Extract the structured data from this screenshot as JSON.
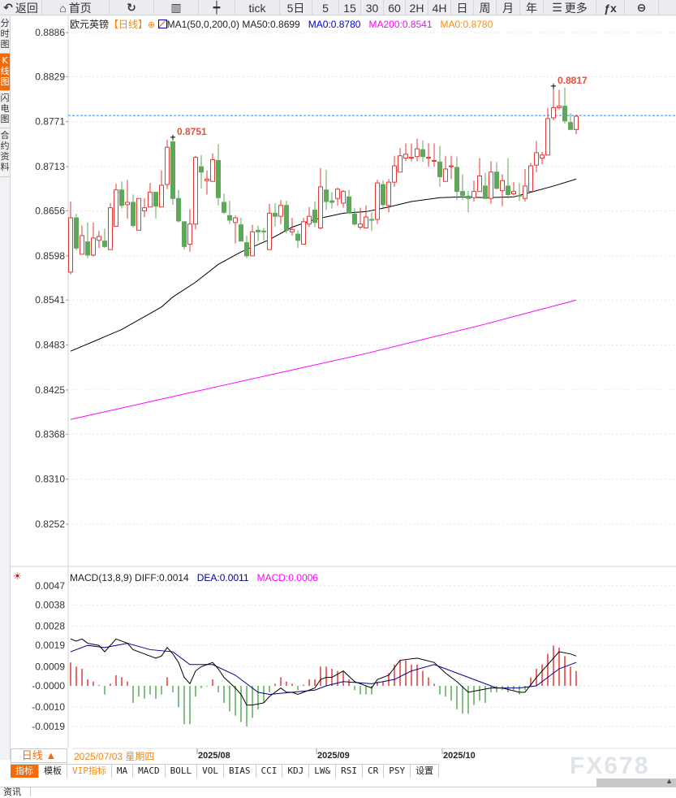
{
  "toolbar": {
    "items": [
      {
        "label": "返回",
        "icon": "back-arrow-icon"
      },
      {
        "label": "首页",
        "icon": "home-icon"
      },
      {
        "label": "",
        "icon": "refresh-icon"
      },
      {
        "label": "",
        "icon": "bar-chart-icon"
      },
      {
        "label": "",
        "icon": "candlestick-icon"
      },
      {
        "label": "tick"
      },
      {
        "label": "5日"
      },
      {
        "label": "5"
      },
      {
        "label": "15"
      },
      {
        "label": "30"
      },
      {
        "label": "60"
      },
      {
        "label": "2H"
      },
      {
        "label": "4H"
      },
      {
        "label": "日"
      },
      {
        "label": "周"
      },
      {
        "label": "月"
      },
      {
        "label": "年"
      },
      {
        "label": "更多",
        "icon": "menu-icon"
      },
      {
        "label": "",
        "icon": "function-fx-icon"
      },
      {
        "label": "",
        "icon": "zoom-out-icon"
      }
    ]
  },
  "side_tabs": [
    {
      "label": "分时图"
    },
    {
      "label": "K线图",
      "active": true
    },
    {
      "label": "闪电图"
    },
    {
      "label": "合约资料"
    }
  ],
  "main_header": {
    "symbol": "欧元英镑",
    "period": "【日线】",
    "indicator": "MA1(50,0,200,0)",
    "ma50": "MA50:0.8699",
    "ma0": "MA0:0.8780",
    "ma200": "MA200:0.8541",
    "ma0b": "MA0:0.8780"
  },
  "macd_header": {
    "name": "MACD(13,8,9)",
    "diff": "DIFF:0.0014",
    "dea": "DEA:0.0011",
    "macd": "MACD:0.0006"
  },
  "colors": {
    "up": "#e03a3a",
    "down": "#5fa85a",
    "ma50": "#000000",
    "ma200": "#ff00ff",
    "dea": "#00008b",
    "diff": "#000000",
    "accent": "#f26b0a",
    "last_price_line": "#1e90ff",
    "ma0": "#0000cc",
    "ma0b": "#ff8c00"
  },
  "chart_data": [
    {
      "type": "candlestick",
      "y_ticks": [
        "0.8886",
        "0.8829",
        "0.8771",
        "0.8713",
        "0.8656",
        "0.8598",
        "0.8541",
        "0.8483",
        "0.8425",
        "0.8368",
        "0.8310",
        "0.8252"
      ],
      "ylim": [
        0.8252,
        0.8886
      ],
      "x_labels": [
        "2025/08",
        "2025/09",
        "2025/10"
      ],
      "annotations": [
        {
          "text": "0.8751",
          "index": 18
        },
        {
          "text": "0.8817",
          "index": 85
        }
      ],
      "last_price": 0.8779,
      "ohlc": [
        [
          0.8577,
          0.8668,
          0.8574,
          0.8647
        ],
        [
          0.8647,
          0.8652,
          0.8605,
          0.8608
        ],
        [
          0.86,
          0.8637,
          0.86,
          0.8624
        ],
        [
          0.8616,
          0.8641,
          0.8595,
          0.8599
        ],
        [
          0.8599,
          0.8641,
          0.8597,
          0.8621
        ],
        [
          0.8618,
          0.863,
          0.8608,
          0.8623
        ],
        [
          0.8617,
          0.8633,
          0.8608,
          0.861
        ],
        [
          0.8606,
          0.8666,
          0.8606,
          0.866
        ],
        [
          0.8636,
          0.8691,
          0.8636,
          0.8683
        ],
        [
          0.8683,
          0.8694,
          0.8659,
          0.8663
        ],
        [
          0.8664,
          0.8696,
          0.8646,
          0.8667
        ],
        [
          0.8667,
          0.8677,
          0.8635,
          0.8637
        ],
        [
          0.8631,
          0.8672,
          0.8631,
          0.8672
        ],
        [
          0.8656,
          0.8672,
          0.8648,
          0.866
        ],
        [
          0.8661,
          0.8692,
          0.8661,
          0.868
        ],
        [
          0.868,
          0.868,
          0.8646,
          0.8662
        ],
        [
          0.8661,
          0.8708,
          0.8661,
          0.8689
        ],
        [
          0.869,
          0.8748,
          0.8684,
          0.8738
        ],
        [
          0.8745,
          0.8751,
          0.8664,
          0.8672
        ],
        [
          0.8672,
          0.8683,
          0.8641,
          0.8643
        ],
        [
          0.8642,
          0.8642,
          0.8606,
          0.861
        ],
        [
          0.8613,
          0.8658,
          0.8603,
          0.8639
        ],
        [
          0.8639,
          0.8727,
          0.8632,
          0.8725
        ],
        [
          0.8713,
          0.8728,
          0.8685,
          0.8706
        ],
        [
          0.8695,
          0.8708,
          0.8677,
          0.8697
        ],
        [
          0.8694,
          0.873,
          0.8694,
          0.8722
        ],
        [
          0.8721,
          0.8742,
          0.8663,
          0.8673
        ],
        [
          0.8667,
          0.8678,
          0.8652,
          0.8654
        ],
        [
          0.865,
          0.8669,
          0.8639,
          0.8644
        ],
        [
          0.8641,
          0.865,
          0.8614,
          0.8647
        ],
        [
          0.8638,
          0.8647,
          0.8617,
          0.8617
        ],
        [
          0.8615,
          0.8624,
          0.8595,
          0.8598
        ],
        [
          0.8598,
          0.8638,
          0.8598,
          0.8629
        ],
        [
          0.8631,
          0.8637,
          0.8617,
          0.8629
        ],
        [
          0.863,
          0.8634,
          0.8618,
          0.8629
        ],
        [
          0.8606,
          0.8665,
          0.8606,
          0.8653
        ],
        [
          0.8653,
          0.8666,
          0.8636,
          0.8649
        ],
        [
          0.8649,
          0.867,
          0.8639,
          0.8663
        ],
        [
          0.8663,
          0.8669,
          0.8627,
          0.8631
        ],
        [
          0.8629,
          0.8647,
          0.8624,
          0.8632
        ],
        [
          0.8626,
          0.8631,
          0.8608,
          0.8618
        ],
        [
          0.8613,
          0.8647,
          0.8613,
          0.8642
        ],
        [
          0.8639,
          0.8661,
          0.8635,
          0.8649
        ],
        [
          0.8657,
          0.8668,
          0.8635,
          0.8641
        ],
        [
          0.8634,
          0.8711,
          0.8632,
          0.8687
        ],
        [
          0.8683,
          0.8709,
          0.8657,
          0.8668
        ],
        [
          0.8669,
          0.868,
          0.8659,
          0.8667
        ],
        [
          0.8672,
          0.8686,
          0.8663,
          0.8684
        ],
        [
          0.8666,
          0.8683,
          0.866,
          0.8681
        ],
        [
          0.8674,
          0.8683,
          0.8653,
          0.8653
        ],
        [
          0.8652,
          0.866,
          0.8637,
          0.8639
        ],
        [
          0.8635,
          0.866,
          0.8632,
          0.8639
        ],
        [
          0.8634,
          0.8663,
          0.8634,
          0.8648
        ],
        [
          0.8645,
          0.8654,
          0.863,
          0.8644
        ],
        [
          0.8645,
          0.8696,
          0.8639,
          0.8692
        ],
        [
          0.869,
          0.8695,
          0.866,
          0.8664
        ],
        [
          0.8663,
          0.8697,
          0.8654,
          0.8693
        ],
        [
          0.8693,
          0.8727,
          0.8687,
          0.8714
        ],
        [
          0.8706,
          0.8737,
          0.8706,
          0.8727
        ],
        [
          0.8724,
          0.8743,
          0.872,
          0.8729
        ],
        [
          0.8724,
          0.8743,
          0.872,
          0.8725
        ],
        [
          0.8726,
          0.8749,
          0.872,
          0.8736
        ],
        [
          0.8735,
          0.8747,
          0.8719,
          0.8726
        ],
        [
          0.8724,
          0.8743,
          0.8713,
          0.8725
        ],
        [
          0.872,
          0.8743,
          0.8713,
          0.8721
        ],
        [
          0.8719,
          0.874,
          0.8687,
          0.87
        ],
        [
          0.8694,
          0.8727,
          0.8694,
          0.871
        ],
        [
          0.8713,
          0.8727,
          0.8697,
          0.8714
        ],
        [
          0.8712,
          0.8726,
          0.867,
          0.8681
        ],
        [
          0.8681,
          0.8703,
          0.867,
          0.8676
        ],
        [
          0.8675,
          0.8682,
          0.8654,
          0.8672
        ],
        [
          0.8673,
          0.8695,
          0.8668,
          0.8681
        ],
        [
          0.8681,
          0.8724,
          0.8681,
          0.8701
        ],
        [
          0.8688,
          0.8705,
          0.8672,
          0.8672
        ],
        [
          0.8672,
          0.872,
          0.8665,
          0.8706
        ],
        [
          0.8706,
          0.8719,
          0.8684,
          0.8685
        ],
        [
          0.8682,
          0.8703,
          0.8662,
          0.8695
        ],
        [
          0.8688,
          0.8724,
          0.8672,
          0.8677
        ],
        [
          0.8678,
          0.8693,
          0.8676,
          0.8681
        ],
        [
          0.8676,
          0.8692,
          0.8669,
          0.8675
        ],
        [
          0.8672,
          0.871,
          0.8668,
          0.8688
        ],
        [
          0.8681,
          0.8718,
          0.8681,
          0.8714
        ],
        [
          0.8715,
          0.8746,
          0.8706,
          0.8731
        ],
        [
          0.8724,
          0.8732,
          0.8716,
          0.8728
        ],
        [
          0.8728,
          0.8789,
          0.8728,
          0.8775
        ],
        [
          0.8776,
          0.8817,
          0.8773,
          0.8789
        ],
        [
          0.8789,
          0.8812,
          0.8787,
          0.8791
        ],
        [
          0.8791,
          0.8815,
          0.8769,
          0.8772
        ],
        [
          0.877,
          0.8782,
          0.876,
          0.8761
        ],
        [
          0.8761,
          0.878,
          0.8755,
          0.8778
        ]
      ],
      "ma50": [
        [
          0,
          0.8475
        ],
        [
          9,
          0.8503
        ],
        [
          16,
          0.8532
        ],
        [
          18,
          0.8545
        ],
        [
          22,
          0.8564
        ],
        [
          26,
          0.8587
        ],
        [
          30,
          0.8603
        ],
        [
          35,
          0.8619
        ],
        [
          39,
          0.8635
        ],
        [
          43,
          0.8645
        ],
        [
          48,
          0.8653
        ],
        [
          52,
          0.8655
        ],
        [
          56,
          0.8661
        ],
        [
          60,
          0.8668
        ],
        [
          65,
          0.8673
        ],
        [
          69,
          0.8674
        ],
        [
          73,
          0.8673
        ],
        [
          78,
          0.8674
        ],
        [
          80,
          0.8678
        ],
        [
          85,
          0.8688
        ],
        [
          89,
          0.8697
        ]
      ],
      "ma200": [
        [
          0,
          0.8387
        ],
        [
          25,
          0.8428
        ],
        [
          52,
          0.8472
        ],
        [
          73,
          0.851
        ],
        [
          89,
          0.8541
        ]
      ]
    },
    {
      "type": "macd",
      "y_ticks": [
        "0.0047",
        "0.0038",
        "0.0028",
        "0.0019",
        "0.0009",
        "-0.0000",
        "-0.0010",
        "-0.0019"
      ],
      "ylim": [
        -0.0019,
        0.0047
      ],
      "histogram": [
        0.0011,
        0.0009,
        0.0008,
        0.0003,
        0.0002,
        4e-05,
        -0.0004,
        0.0001,
        0.0005,
        0.0004,
        0.0002,
        -0.0008,
        -0.0005,
        -0.0006,
        -0.0004,
        -0.0006,
        -0.0004,
        0.0004,
        -0.0003,
        -0.001,
        -0.0018,
        -0.0018,
        -0.0005,
        -0.0001,
        -3e-05,
        0.0003,
        -0.0003,
        -0.0008,
        -0.0012,
        -0.0014,
        -0.0017,
        -0.0019,
        -0.0015,
        -0.0011,
        -0.0008,
        -0.0003,
        0.0001,
        0.0004,
        0.0002,
        0.0001,
        -0.0002,
        5e-05,
        0.0003,
        0.0003,
        0.0009,
        0.0009,
        0.0008,
        0.0007,
        0.0007,
        0.0003,
        -0.0002,
        -0.0004,
        -0.0004,
        -0.0004,
        0.0002,
        0.0002,
        0.0006,
        0.001,
        0.0012,
        0.0012,
        0.001,
        0.001,
        0.0007,
        0.0004,
        0.0001,
        -0.0004,
        -0.0005,
        -0.0007,
        -0.0011,
        -0.0013,
        -0.0013,
        -0.0009,
        -0.0007,
        -0.0008,
        -0.0003,
        -0.0003,
        -0.0002,
        -0.0003,
        -0.0002,
        -0.0004,
        -0.0002,
        0.0004,
        0.0008,
        0.001,
        0.0015,
        0.0019,
        0.0018,
        0.0014,
        0.0009,
        0.0007
      ],
      "diff": [
        [
          0,
          0.0022
        ],
        [
          1,
          0.0021
        ],
        [
          2,
          0.0022
        ],
        [
          3,
          0.002
        ],
        [
          5,
          0.0019
        ],
        [
          6,
          0.0016
        ],
        [
          8,
          0.0022
        ],
        [
          10,
          0.002
        ],
        [
          11,
          0.0017
        ],
        [
          13,
          0.0015
        ],
        [
          15,
          0.0013
        ],
        [
          16,
          0.0014
        ],
        [
          17,
          0.0018
        ],
        [
          18,
          0.0015
        ],
        [
          19,
          0.0011
        ],
        [
          20,
          0.0004
        ],
        [
          21,
          0.0001
        ],
        [
          22,
          0.0007
        ],
        [
          23,
          0.0009
        ],
        [
          25,
          0.0011
        ],
        [
          26,
          0.0008
        ],
        [
          27,
          0.0004
        ],
        [
          29,
          -0.0001
        ],
        [
          30,
          -0.0004
        ],
        [
          31,
          -0.0009
        ],
        [
          32,
          -0.0009
        ],
        [
          34,
          -0.0008
        ],
        [
          35,
          -0.0005
        ],
        [
          37,
          -0.0001
        ],
        [
          38,
          -0.0003
        ],
        [
          39,
          -0.0003
        ],
        [
          40,
          -0.0004
        ],
        [
          42,
          -0.0002
        ],
        [
          43,
          -0.0001
        ],
        [
          44,
          0.0003
        ],
        [
          45,
          0.0004
        ],
        [
          46,
          0.0004
        ],
        [
          48,
          0.0007
        ],
        [
          50,
          0.0002
        ],
        [
          53,
          -0.0001
        ],
        [
          54,
          0.0003
        ],
        [
          56,
          0.0005
        ],
        [
          58,
          0.0012
        ],
        [
          61,
          0.0013
        ],
        [
          64,
          0.0011
        ],
        [
          66,
          0.0006
        ],
        [
          68,
          0.0002
        ],
        [
          70,
          -0.0003
        ],
        [
          72,
          -0.0002
        ],
        [
          74,
          -0.0001
        ],
        [
          76,
          -0.0001
        ],
        [
          79,
          -0.0003
        ],
        [
          80,
          -0.0003
        ],
        [
          82,
          0.0004
        ],
        [
          84,
          0.001
        ],
        [
          86,
          0.0016
        ],
        [
          88,
          0.0015
        ],
        [
          89,
          0.0014
        ]
      ],
      "dea": [
        [
          0,
          0.0016
        ],
        [
          3,
          0.0019
        ],
        [
          6,
          0.0018
        ],
        [
          10,
          0.002
        ],
        [
          14,
          0.0017
        ],
        [
          18,
          0.0016
        ],
        [
          21,
          0.001
        ],
        [
          25,
          0.001
        ],
        [
          29,
          0.0005
        ],
        [
          33,
          -0.0003
        ],
        [
          35,
          -0.0004
        ],
        [
          39,
          -0.0003
        ],
        [
          43,
          -0.0002
        ],
        [
          45,
          0.0
        ],
        [
          48,
          0.0002
        ],
        [
          53,
          0.0001
        ],
        [
          57,
          0.0003
        ],
        [
          60,
          0.0007
        ],
        [
          64,
          0.001
        ],
        [
          68,
          0.0006
        ],
        [
          72,
          0.0002
        ],
        [
          75,
          -0.0001
        ],
        [
          79,
          -0.0001
        ],
        [
          82,
          0.0
        ],
        [
          86,
          0.0008
        ],
        [
          89,
          0.0011
        ]
      ]
    }
  ],
  "bottom": {
    "period_button": "日线 ▲",
    "cursor_date": "2025/07/03 星期四",
    "tabs": [
      "指标",
      "模板",
      "VIP指标",
      "MA",
      "MACD",
      "BOLL",
      "VOL",
      "BIAS",
      "CCI",
      "KDJ",
      "LW&",
      "RSI",
      "CR",
      "PSY",
      "设置"
    ],
    "info_tab": "资讯",
    "watermark": "FX678"
  }
}
